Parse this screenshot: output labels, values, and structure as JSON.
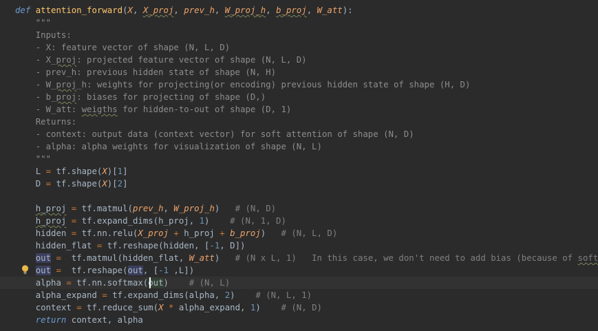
{
  "colors": {
    "background": "#2b2b2b",
    "current_line": "#323232",
    "keyword": "#6b9bd2",
    "function_name": "#ffc66d",
    "docstring": "#8d8d8d",
    "comment": "#808080",
    "operator": "#cc7832",
    "number": "#6897bb",
    "identifier": "#a9b7c6",
    "italic_param": "#eea46b"
  },
  "icons": {
    "gutter_hint": "lightbulb-icon",
    "cursor": "text-caret"
  },
  "code": {
    "current_line_index": 22,
    "lines": [
      [
        {
          "t": "def",
          "c": "kw"
        },
        {
          "t": " "
        },
        {
          "t": "attention_forward",
          "c": "fn"
        },
        {
          "t": "(",
          "c": "punct"
        },
        {
          "t": "X",
          "c": "param-i"
        },
        {
          "t": ", ",
          "c": "punct"
        },
        {
          "t": "X_proj",
          "c": "param-i typo"
        },
        {
          "t": ", ",
          "c": "punct"
        },
        {
          "t": "prev_h",
          "c": "param-i"
        },
        {
          "t": ", ",
          "c": "punct"
        },
        {
          "t": "W_proj_h",
          "c": "param-i typo"
        },
        {
          "t": ", ",
          "c": "punct"
        },
        {
          "t": "b_proj",
          "c": "param-i typo"
        },
        {
          "t": ", ",
          "c": "punct"
        },
        {
          "t": "W_att",
          "c": "param-i"
        },
        {
          "t": "):",
          "c": "punct"
        }
      ],
      [
        {
          "t": "    \"\"\"",
          "c": "doc"
        }
      ],
      [
        {
          "t": "    Inputs:",
          "c": "doc"
        }
      ],
      [
        {
          "t": "    - X: feature vector of shape (N, L, D)",
          "c": "doc"
        }
      ],
      [
        {
          "t": "    - X_",
          "c": "doc"
        },
        {
          "t": "proj",
          "c": "doc typo"
        },
        {
          "t": ": projected feature vector of shape (N, L, D)",
          "c": "doc"
        }
      ],
      [
        {
          "t": "    - prev_h: previous hidden state of shape (N, H)",
          "c": "doc"
        }
      ],
      [
        {
          "t": "    - W_",
          "c": "doc"
        },
        {
          "t": "proj",
          "c": "doc typo"
        },
        {
          "t": "_h: weights for projecting(or encoding) previous hidden state of shape (H, D)",
          "c": "doc"
        }
      ],
      [
        {
          "t": "    - b_",
          "c": "doc"
        },
        {
          "t": "proj",
          "c": "doc typo"
        },
        {
          "t": ": biases for projecting of shape (D,)",
          "c": "doc"
        }
      ],
      [
        {
          "t": "    - W_att: ",
          "c": "doc"
        },
        {
          "t": "weigths",
          "c": "doc typo"
        },
        {
          "t": " for hidden-to-out of shape (D, 1)",
          "c": "doc"
        }
      ],
      [
        {
          "t": "    Returns:",
          "c": "doc"
        }
      ],
      [
        {
          "t": "    - context: output data (context vector) for soft attention of shape (N, D)",
          "c": "doc"
        }
      ],
      [
        {
          "t": "    - alpha: alpha weights for visualization of shape (N, L)",
          "c": "doc"
        }
      ],
      [
        {
          "t": "    \"\"\"",
          "c": "doc"
        }
      ],
      [
        {
          "t": "    L "
        },
        {
          "t": "=",
          "c": "op"
        },
        {
          "t": " tf.shape("
        },
        {
          "t": "X",
          "c": "param-i"
        },
        {
          "t": ")["
        },
        {
          "t": "1",
          "c": "num"
        },
        {
          "t": "]"
        }
      ],
      [
        {
          "t": "    D "
        },
        {
          "t": "=",
          "c": "op"
        },
        {
          "t": " tf.shape("
        },
        {
          "t": "X",
          "c": "param-i"
        },
        {
          "t": ")["
        },
        {
          "t": "2",
          "c": "num"
        },
        {
          "t": "]"
        }
      ],
      [
        {
          "t": ""
        }
      ],
      [
        {
          "t": "    "
        },
        {
          "t": "h_proj",
          "c": "ident typo"
        },
        {
          "t": " "
        },
        {
          "t": "=",
          "c": "op"
        },
        {
          "t": " tf.matmul("
        },
        {
          "t": "prev_h",
          "c": "param-i"
        },
        {
          "t": ", "
        },
        {
          "t": "W_proj_h",
          "c": "param-i"
        },
        {
          "t": ")   "
        },
        {
          "t": "# (N, D)",
          "c": "cmt"
        }
      ],
      [
        {
          "t": "    "
        },
        {
          "t": "h_proj",
          "c": "ident typo"
        },
        {
          "t": " "
        },
        {
          "t": "=",
          "c": "op"
        },
        {
          "t": " tf.expand_dims(h_proj, "
        },
        {
          "t": "1",
          "c": "num"
        },
        {
          "t": ")    "
        },
        {
          "t": "# (N, 1, D)",
          "c": "cmt"
        }
      ],
      [
        {
          "t": "    hidden "
        },
        {
          "t": "=",
          "c": "op"
        },
        {
          "t": " tf.nn.relu("
        },
        {
          "t": "X_proj",
          "c": "param-i"
        },
        {
          "t": " "
        },
        {
          "t": "+",
          "c": "op"
        },
        {
          "t": " h_proj "
        },
        {
          "t": "+",
          "c": "op"
        },
        {
          "t": " "
        },
        {
          "t": "b_proj",
          "c": "param-i"
        },
        {
          "t": ")   "
        },
        {
          "t": "# (N, L, D)",
          "c": "cmt"
        }
      ],
      [
        {
          "t": "    hidden_flat "
        },
        {
          "t": "=",
          "c": "op"
        },
        {
          "t": " tf.reshape(hidden, ["
        },
        {
          "t": "-1",
          "c": "num"
        },
        {
          "t": ", D])"
        }
      ],
      [
        {
          "t": "    "
        },
        {
          "t": "out",
          "c": "ident hl"
        },
        {
          "t": " "
        },
        {
          "t": "=",
          "c": "op"
        },
        {
          "t": "  tf.matmul(hidden_flat, "
        },
        {
          "t": "W_att",
          "c": "param-i"
        },
        {
          "t": ")   "
        },
        {
          "t": "# (N x L, 1)   In this case, we don't need to add bias (because of ",
          "c": "cmt"
        },
        {
          "t": "softmax",
          "c": "cmt typo"
        },
        {
          "t": ").",
          "c": "cmt"
        }
      ],
      [
        {
          "t": "    "
        },
        {
          "t": "out",
          "c": "ident hl"
        },
        {
          "t": " "
        },
        {
          "t": "=",
          "c": "op"
        },
        {
          "t": "  tf.reshape("
        },
        {
          "t": "out",
          "c": "ident hl"
        },
        {
          "t": ", ["
        },
        {
          "t": "-1",
          "c": "num"
        },
        {
          "t": " ,L])"
        }
      ],
      [
        {
          "t": "    alpha "
        },
        {
          "t": "=",
          "c": "op"
        },
        {
          "t": " tf.nn.softmax("
        },
        {
          "t": "out",
          "c": "ident hl2"
        },
        {
          "t": ")    "
        },
        {
          "t": "# (N, L)",
          "c": "cmt"
        }
      ],
      [
        {
          "t": "    alpha_expand "
        },
        {
          "t": "=",
          "c": "op"
        },
        {
          "t": " tf.expand_dims(alpha, "
        },
        {
          "t": "2",
          "c": "num"
        },
        {
          "t": ")    "
        },
        {
          "t": "# (N, L, 1)",
          "c": "cmt"
        }
      ],
      [
        {
          "t": "    context "
        },
        {
          "t": "=",
          "c": "op"
        },
        {
          "t": " tf.reduce_sum("
        },
        {
          "t": "X",
          "c": "param-i"
        },
        {
          "t": " "
        },
        {
          "t": "*",
          "c": "op"
        },
        {
          "t": " alpha_expand, "
        },
        {
          "t": "1",
          "c": "num"
        },
        {
          "t": ")    "
        },
        {
          "t": "# (N, D)",
          "c": "cmt"
        }
      ],
      [
        {
          "t": "    "
        },
        {
          "t": "return",
          "c": "kw"
        },
        {
          "t": " context, alpha"
        }
      ]
    ]
  }
}
